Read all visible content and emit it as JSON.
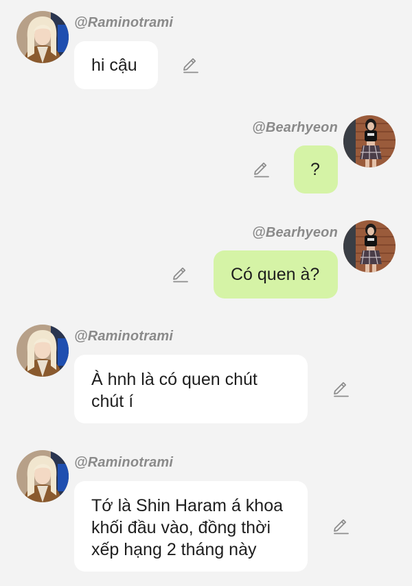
{
  "messages": [
    {
      "sender": "@Raminotrami",
      "text": "hi cậu",
      "side": "left"
    },
    {
      "sender": "@Bearhyeon",
      "text": "?",
      "side": "right"
    },
    {
      "sender": "@Bearhyeon",
      "text": "Có quen à?",
      "side": "right"
    },
    {
      "sender": "@Raminotrami",
      "text": "À hnh là có quen chút\nchút í",
      "side": "left"
    },
    {
      "sender": "@Raminotrami",
      "text": "Tớ là Shin Haram á khoa\nkhối đầu vào, đồng thời\nxếp hạng 2 tháng này",
      "side": "left"
    }
  ],
  "colors": {
    "background": "#f3f3f3",
    "bubble_left": "#ffffff",
    "bubble_right": "#d5f3a6",
    "username": "#8a8a8a"
  },
  "icons": {
    "avatar_left": "avatar-raminotrami",
    "avatar_right": "avatar-bearhyeon",
    "edit": "pencil-edit-icon"
  }
}
